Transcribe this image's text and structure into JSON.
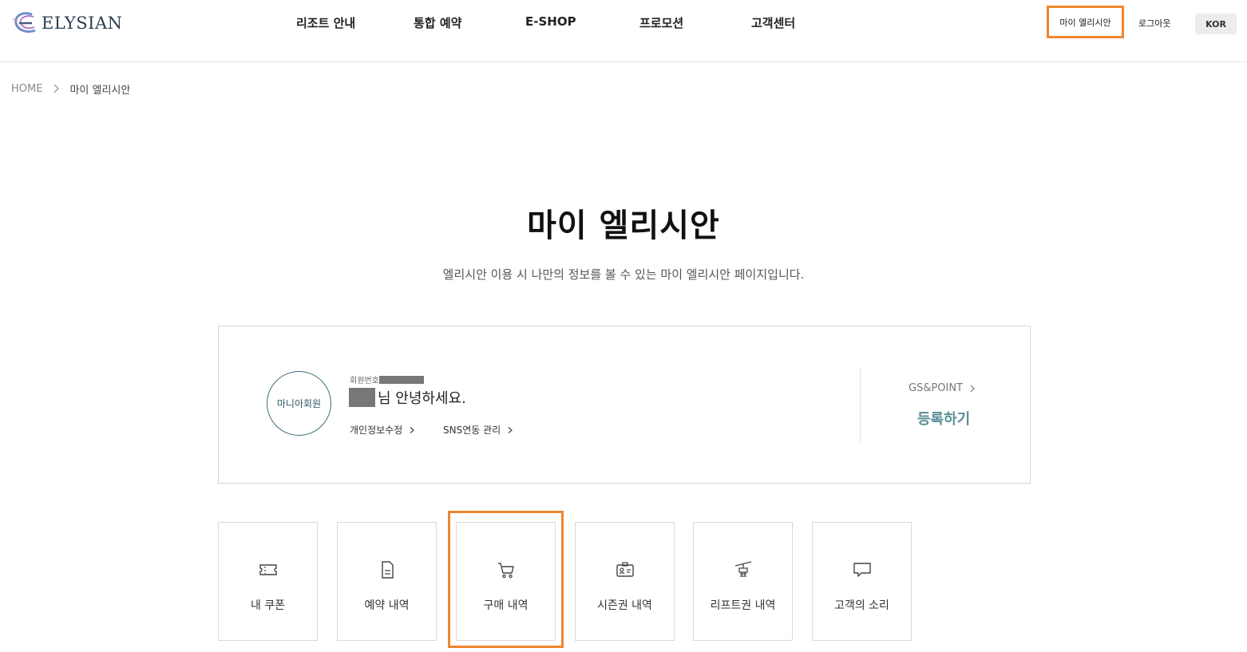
{
  "header": {
    "logo_text": "ELYSIAN",
    "nav": [
      {
        "label": "리조트 안내"
      },
      {
        "label": "통합 예약"
      },
      {
        "label": "E-SHOP"
      },
      {
        "label": "프로모션"
      },
      {
        "label": "고객센터"
      }
    ],
    "util": {
      "my_elysian": "마이 엘리시안",
      "logout": "로그아웃",
      "language": "KOR"
    }
  },
  "breadcrumb": {
    "home": "HOME",
    "current": "마이 엘리시안"
  },
  "page": {
    "title": "마이 엘리시안",
    "description": "엘리시안 이용 시 나만의 정보를 볼 수 있는 마이 엘리시안 페이지입니다."
  },
  "member": {
    "grade": "마니아회원",
    "member_no_label": "회원번호",
    "greeting_suffix": "님 안녕하세요.",
    "edit_profile": "개인정보수정",
    "sns_link": "SNS연동 관리",
    "gs_point": "GS&POINT",
    "register": "등록하기"
  },
  "menu": [
    {
      "label": "내 쿠폰",
      "icon": "coupon-icon"
    },
    {
      "label": "예약 내역",
      "icon": "document-icon"
    },
    {
      "label": "구매 내역",
      "icon": "cart-icon"
    },
    {
      "label": "시즌권 내역",
      "icon": "id-card-icon"
    },
    {
      "label": "리프트권 내역",
      "icon": "ski-lift-icon"
    },
    {
      "label": "고객의 소리",
      "icon": "speech-bubble-icon"
    }
  ],
  "colors": {
    "highlight": "#f0862d",
    "accent": "#5a8f96",
    "grade_circle": "#3a6f78"
  }
}
